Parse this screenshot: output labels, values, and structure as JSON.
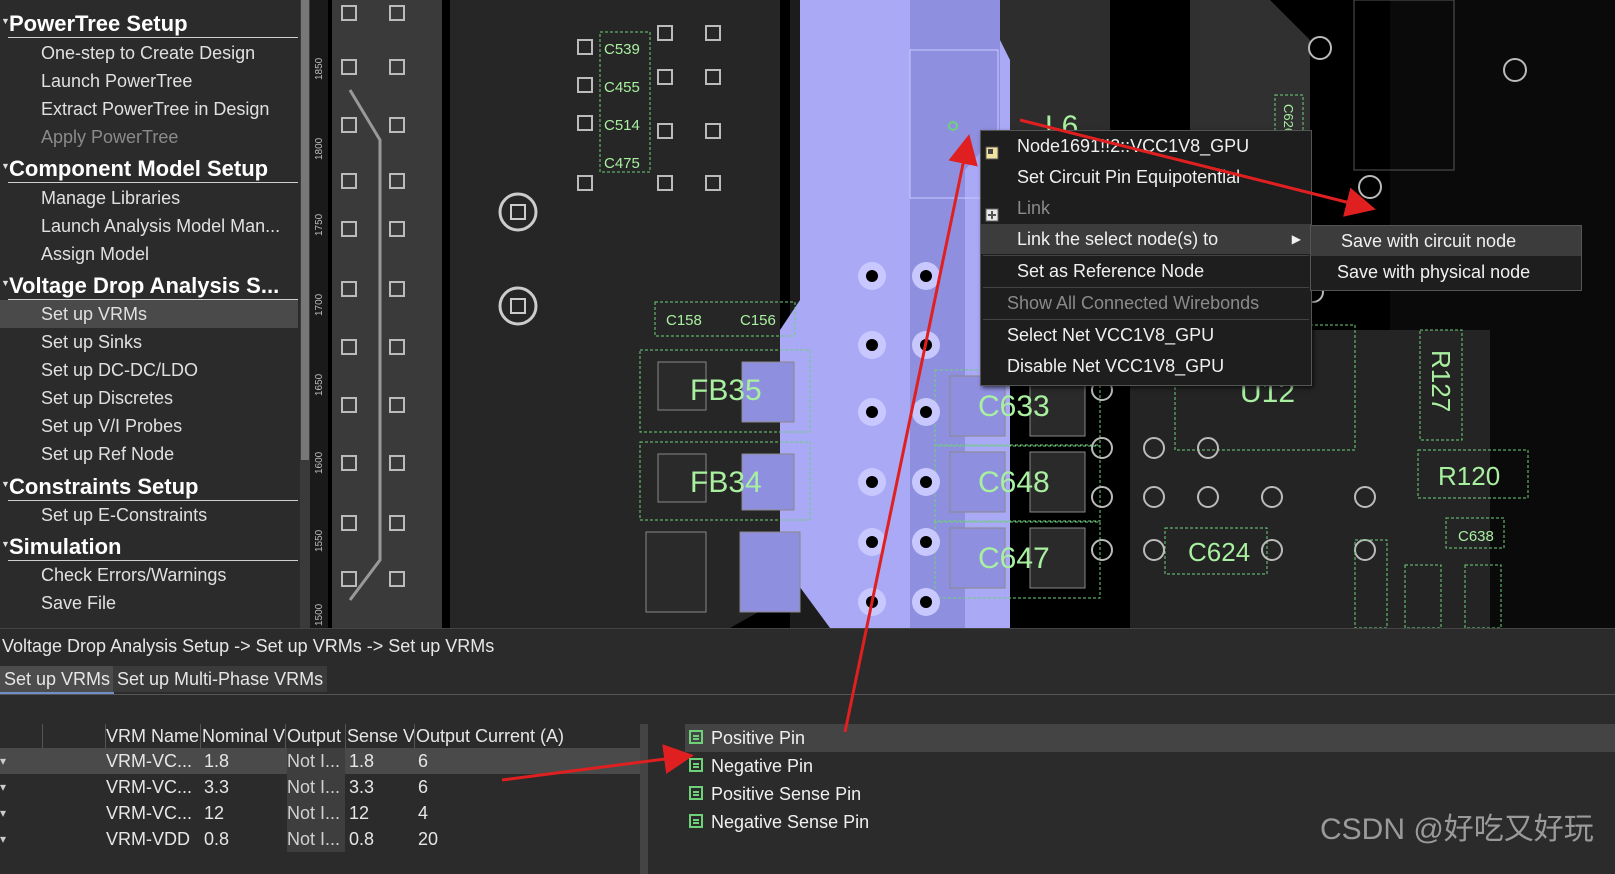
{
  "workflow": {
    "sections": [
      {
        "title": "PowerTree Setup",
        "items": [
          {
            "label": "One-step to Create Design",
            "state": "normal"
          },
          {
            "label": "Launch PowerTree",
            "state": "normal"
          },
          {
            "label": "Extract PowerTree in Design",
            "state": "normal"
          },
          {
            "label": "Apply PowerTree",
            "state": "disabled"
          }
        ]
      },
      {
        "title": "Component Model Setup",
        "items": [
          {
            "label": "Manage Libraries",
            "state": "normal"
          },
          {
            "label": "Launch Analysis Model Man...",
            "state": "normal"
          },
          {
            "label": "Assign Model",
            "state": "normal"
          }
        ]
      },
      {
        "title": "Voltage Drop Analysis S...",
        "items": [
          {
            "label": "Set up VRMs",
            "state": "selected"
          },
          {
            "label": "Set up Sinks",
            "state": "normal"
          },
          {
            "label": "Set up DC-DC/LDO",
            "state": "normal"
          },
          {
            "label": "Set up Discretes",
            "state": "normal"
          },
          {
            "label": "Set up V/I Probes",
            "state": "normal"
          },
          {
            "label": "Set up Ref Node",
            "state": "normal"
          }
        ]
      },
      {
        "title": "Constraints Setup",
        "items": [
          {
            "label": "Set up E-Constraints",
            "state": "normal"
          }
        ]
      },
      {
        "title": "Simulation",
        "items": [
          {
            "label": "Check Errors/Warnings",
            "state": "normal"
          },
          {
            "label": "Save File",
            "state": "normal"
          }
        ]
      }
    ]
  },
  "ruler": {
    "ticks": [
      "1850",
      "1800",
      "1750",
      "1700",
      "1650",
      "1600",
      "1550",
      "1500"
    ]
  },
  "layout_labels": {
    "l6": "L6",
    "u12": "U12",
    "fb35": "FB35",
    "fb34": "FB34",
    "c633": "C633",
    "c648": "C648",
    "c647": "C647",
    "c624": "C624",
    "r120": "R120",
    "r127": "R127",
    "c638": "C638",
    "c539": "C539",
    "c455": "C455",
    "c514": "C514",
    "c475": "C475",
    "c158": "C158",
    "c156": "C156",
    "c626": "C626"
  },
  "context_menu": {
    "items": [
      {
        "label": "Node1691!!2::VCC1V8_GPU",
        "state": "normal",
        "icon": "node-icon"
      },
      {
        "label": "Set Circuit Pin Equipotential",
        "state": "normal"
      },
      {
        "label": "Link",
        "state": "disabled",
        "icon": "link-icon"
      },
      {
        "label": "Link the select node(s) to",
        "state": "highlighted",
        "submenu": true
      },
      {
        "label": "Set as Reference Node",
        "state": "normal"
      },
      {
        "label": "Show All Connected Wirebonds",
        "state": "disabled"
      },
      {
        "label": "Select Net VCC1V8_GPU",
        "state": "normal"
      },
      {
        "label": "Disable Net VCC1V8_GPU",
        "state": "normal"
      }
    ],
    "submenu": [
      {
        "label": "Save with circuit node",
        "state": "highlighted"
      },
      {
        "label": "Save with physical node",
        "state": "normal"
      }
    ]
  },
  "bottom": {
    "breadcrumb": "Voltage Drop Analysis Setup -> Set up VRMs -> Set up VRMs",
    "tabs": [
      "Set up VRMs",
      "Set up Multi-Phase VRMs"
    ],
    "vrm_table": {
      "columns": [
        "VRM Name",
        "Nominal V",
        "Output",
        "Sense V",
        "Output Current (A)"
      ],
      "rows": [
        [
          "VRM-VC...",
          "1.8",
          "Not I...",
          "1.8",
          "6"
        ],
        [
          "VRM-VC...",
          "3.3",
          "Not I...",
          "3.3",
          "6"
        ],
        [
          "VRM-VC...",
          "12",
          "Not I...",
          "12",
          "4"
        ],
        [
          "VRM-VDD",
          "0.8",
          "Not I...",
          "0.8",
          "20"
        ]
      ]
    },
    "pins": [
      "Positive Pin",
      "Negative Pin",
      "Positive Sense Pin",
      "Negative Sense Pin"
    ]
  },
  "watermark": "CSDN @好吃又好玩",
  "colors": {
    "accent": "#6f8fc8",
    "net_highlight": "#a9a9f5",
    "silkscreen": "#a8f0a0",
    "annotation_arrow": "#e02020"
  }
}
